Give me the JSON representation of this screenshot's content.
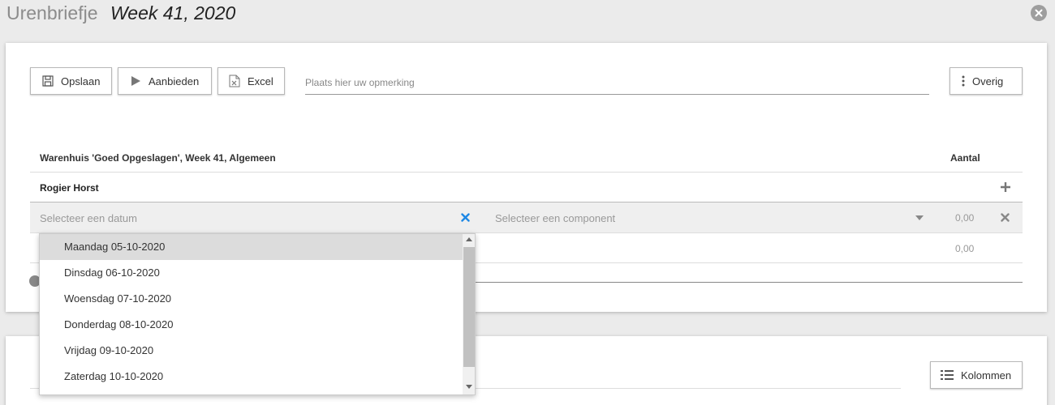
{
  "window": {
    "title": "Urenbriefje",
    "week_title": "Week 41, 2020"
  },
  "toolbar": {
    "save_label": "Opslaan",
    "submit_label": "Aanbieden",
    "excel_label": "Excel",
    "remark_placeholder": "Plaats hier uw opmerking",
    "remark_value": "",
    "more_label": "Overig"
  },
  "table": {
    "header_left": "Warenhuis 'Goed Opgeslagen', Week 41, Algemeen",
    "header_right": "Aantal",
    "person": "Rogier Horst",
    "date_placeholder": "Selecteer een datum",
    "component_placeholder": "Selecteer een component",
    "row_value": "0,00",
    "total_value": "0,00"
  },
  "dropdown": {
    "items": [
      "Maandag 05-10-2020",
      "Dinsdag 06-10-2020",
      "Woensdag 07-10-2020",
      "Donderdag 08-10-2020",
      "Vrijdag 09-10-2020",
      "Zaterdag 10-10-2020"
    ],
    "highlighted": "Maandag 05-10-2020"
  },
  "panel2": {
    "columns_label": "Kolommen"
  },
  "icons": {
    "close": "close-icon",
    "save": "floppy-disk-icon",
    "submit": "play-icon",
    "excel": "excel-file-icon",
    "more": "vertical-dots-icon",
    "add": "plus-icon",
    "clear": "clear-x-icon",
    "caret": "caret-down-icon",
    "delete": "delete-x-icon",
    "columns": "list-icon"
  },
  "colors": {
    "accent_clear": "#1e88e5",
    "highlight_row": "#dcdcdc"
  }
}
